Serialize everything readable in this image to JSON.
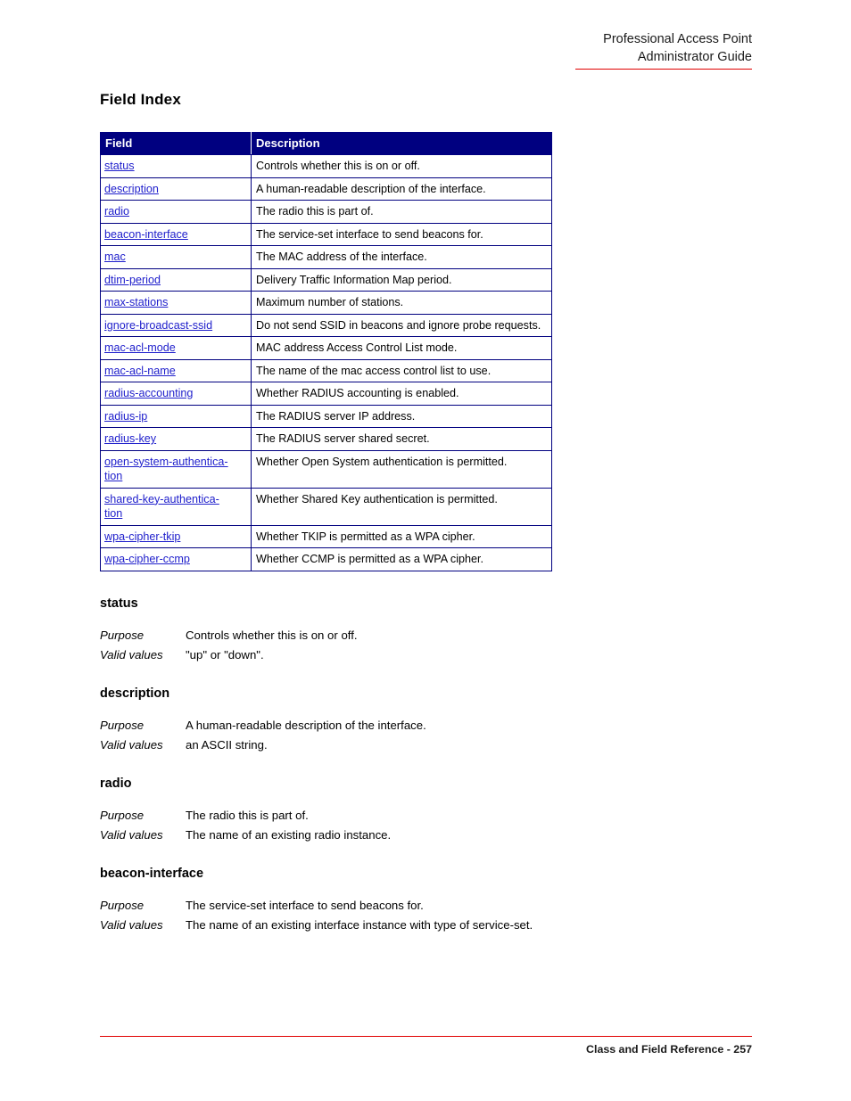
{
  "header": {
    "line1": "Professional Access Point",
    "line2": "Administrator Guide"
  },
  "page_title": "Field Index",
  "table": {
    "columns": [
      "Field",
      "Description"
    ],
    "rows": [
      {
        "field": "status",
        "field_wrap": null,
        "description": "Controls whether this is on or off."
      },
      {
        "field": "description",
        "field_wrap": null,
        "description": "A human-readable description of the interface."
      },
      {
        "field": "radio",
        "field_wrap": null,
        "description": "The radio this is part of."
      },
      {
        "field": "beacon-interface",
        "field_wrap": null,
        "description": "The service-set interface to send beacons for."
      },
      {
        "field": "mac",
        "field_wrap": null,
        "description": "The MAC address of the interface."
      },
      {
        "field": "dtim-period",
        "field_wrap": null,
        "description": "Delivery Traffic Information Map period."
      },
      {
        "field": "max-stations",
        "field_wrap": null,
        "description": "Maximum number of stations."
      },
      {
        "field": "ignore-broadcast-ssid",
        "field_wrap": null,
        "description": "Do not send SSID in beacons and ignore probe requests."
      },
      {
        "field": "mac-acl-mode",
        "field_wrap": null,
        "description": "MAC address Access Control List mode."
      },
      {
        "field": "mac-acl-name",
        "field_wrap": null,
        "description": "The name of the mac access control list to use."
      },
      {
        "field": "radius-accounting",
        "field_wrap": null,
        "description": "Whether RADIUS accounting is enabled."
      },
      {
        "field": "radius-ip",
        "field_wrap": null,
        "description": "The RADIUS server IP address."
      },
      {
        "field": "radius-key",
        "field_wrap": null,
        "description": "The RADIUS server shared secret."
      },
      {
        "field": "open-system-authentica-",
        "field_wrap": "tion",
        "description": "Whether Open System authentication is permitted."
      },
      {
        "field": "shared-key-authentica-",
        "field_wrap": "tion",
        "description": "Whether Shared Key authentication is permitted."
      },
      {
        "field": "wpa-cipher-tkip",
        "field_wrap": null,
        "description": "Whether TKIP is permitted as a WPA cipher."
      },
      {
        "field": "wpa-cipher-ccmp",
        "field_wrap": null,
        "description": "Whether CCMP is permitted as a WPA cipher."
      }
    ]
  },
  "detail_labels": {
    "purpose": "Purpose",
    "valid_values": "Valid values"
  },
  "details": [
    {
      "name": "status",
      "purpose": "Controls whether this is on or off.",
      "valid_values": "\"up\" or \"down\"."
    },
    {
      "name": "description",
      "purpose": "A human-readable description of the interface.",
      "valid_values": "an ASCII string."
    },
    {
      "name": "radio",
      "purpose": "The radio this is part of.",
      "valid_values": "The name of an existing radio instance."
    },
    {
      "name": "beacon-interface",
      "purpose": "The service-set interface to send beacons for.",
      "valid_values": "The name of an existing interface instance with type of service-set."
    }
  ],
  "footer": {
    "text": "Class and Field Reference - 257"
  },
  "colors": {
    "table_header_bg": "#000080",
    "table_border": "#000080",
    "link": "#2020cc",
    "rule": "#e00000"
  }
}
